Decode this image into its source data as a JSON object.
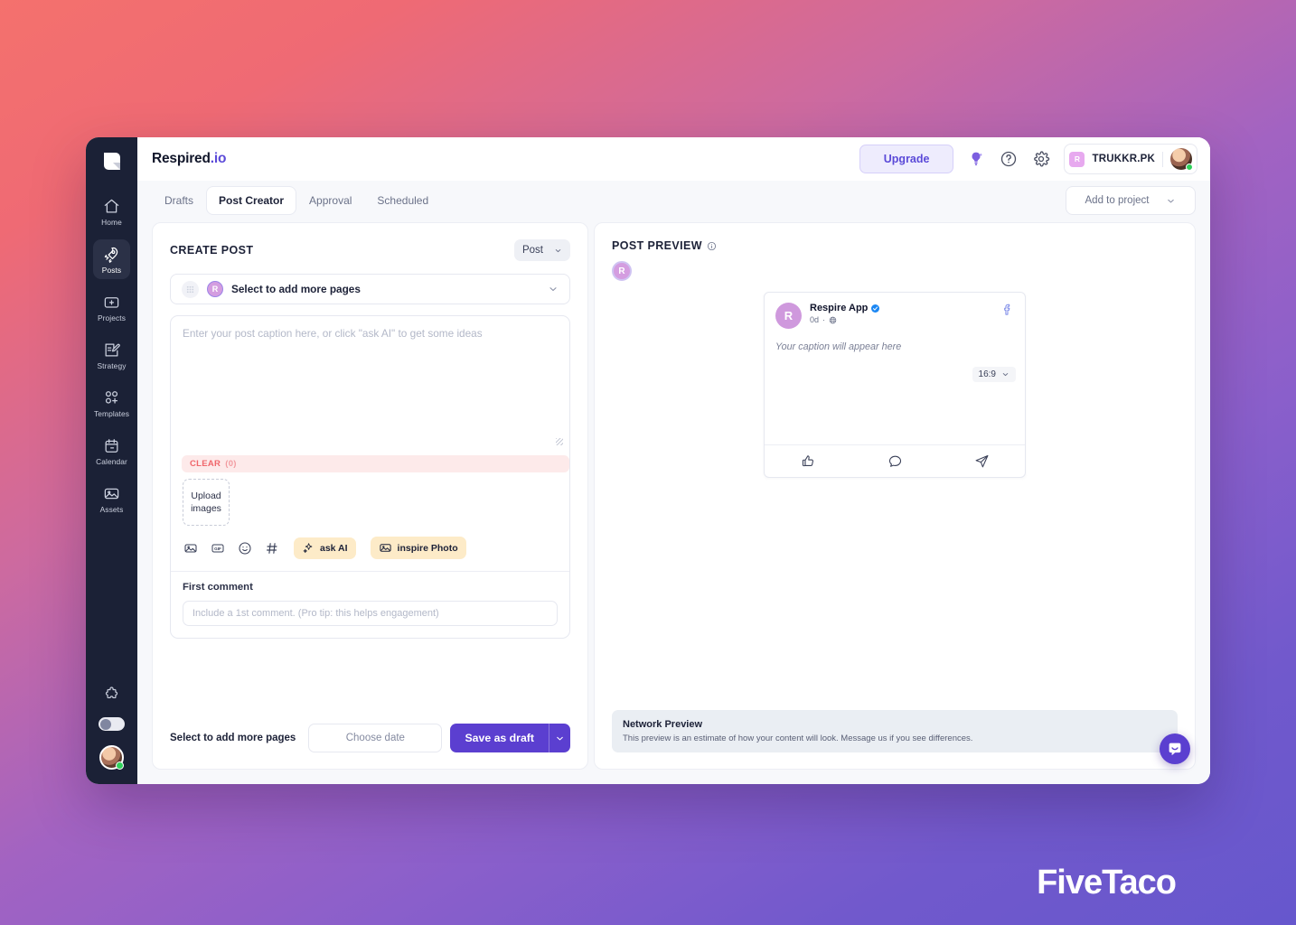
{
  "brand": {
    "name": "Respired",
    "suffix": ".io"
  },
  "topbar": {
    "upgrade_label": "Upgrade",
    "idea_icon": "lightbulb-icon",
    "help_icon": "help-circle-icon",
    "settings_icon": "gear-icon",
    "user_initial": "R",
    "user_name": "TRUKKR.PK"
  },
  "sidebar": {
    "items": [
      {
        "label": "Home",
        "icon": "home-icon",
        "active": false
      },
      {
        "label": "Posts",
        "icon": "rocket-icon",
        "active": true
      },
      {
        "label": "Projects",
        "icon": "folder-plus-icon",
        "active": false
      },
      {
        "label": "Strategy",
        "icon": "note-pencil-icon",
        "active": false
      },
      {
        "label": "Templates",
        "icon": "templates-add-icon",
        "active": false
      },
      {
        "label": "Calendar",
        "icon": "calendar-icon",
        "active": false
      },
      {
        "label": "Assets",
        "icon": "image-icon",
        "active": false
      }
    ],
    "puzzle_icon": "puzzle-icon",
    "theme_toggle": "theme-toggle"
  },
  "tabs": [
    {
      "label": "Drafts",
      "active": false
    },
    {
      "label": "Post Creator",
      "active": true
    },
    {
      "label": "Approval",
      "active": false
    },
    {
      "label": "Scheduled",
      "active": false
    }
  ],
  "add_project": {
    "label": "Add to project"
  },
  "create_post": {
    "title": "CREATE POST",
    "type_select": "Post",
    "pages_select_label": "Select to add more pages",
    "page_initial": "R",
    "caption_placeholder": "Enter your post caption here, or click \"ask AI\" to get some ideas",
    "clear_label": "CLEAR",
    "clear_count": "(0)",
    "upload_label": "Upload images",
    "tools": [
      {
        "name": "image-icon"
      },
      {
        "name": "gif-icon"
      },
      {
        "name": "emoji-icon"
      },
      {
        "name": "hashtag-icon"
      }
    ],
    "ask_ai_label": "ask AI",
    "inspire_photo_label": "inspire Photo",
    "first_comment_label": "First comment",
    "first_comment_placeholder": "Include a 1st comment. (Pro tip: this helps engagement)"
  },
  "footer_actions": {
    "pages_label": "Select to add more pages",
    "date_label": "Choose date",
    "save_label": "Save as draft"
  },
  "preview": {
    "title": "POST PREVIEW",
    "info_icon": "info-icon",
    "account_initial": "R",
    "card": {
      "avatar_initial": "R",
      "name": "Respire App",
      "verified": true,
      "time": "0d",
      "audience_icon": "globe-icon",
      "network_icon": "facebook-icon",
      "caption": "Your caption will appear here",
      "ratio": "16:9",
      "actions": [
        {
          "name": "like-icon"
        },
        {
          "name": "comment-icon"
        },
        {
          "name": "share-icon"
        }
      ]
    },
    "banner": {
      "title": "Network Preview",
      "text": "This preview is an estimate of how your content will look. Message us if you see differences."
    }
  },
  "chat": {
    "icon": "intercom-chat-icon"
  },
  "watermark": {
    "text": "FiveTaco"
  },
  "colors": {
    "accent_purple": "#5b3fd0",
    "upgrade_bg": "#eeecfd",
    "clear_red": "#f0666b",
    "ai_pill_bg": "#fdebc8",
    "sidebar_bg": "#1b2136",
    "status_green": "#2fd15b"
  }
}
